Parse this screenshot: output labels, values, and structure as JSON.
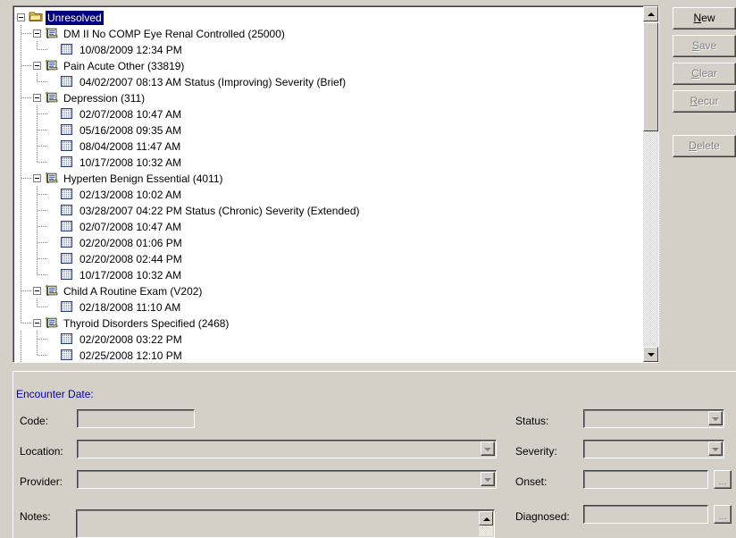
{
  "tree": {
    "root": {
      "label": "Unresolved",
      "icon": "folder-icon",
      "selected": true
    },
    "groups": [
      {
        "label": "DM   II No COMP Eye Renal Controlled (25000)",
        "icon": "diagnosis-icon",
        "entries": [
          {
            "label": "10/08/2009 12:34 PM",
            "icon": "encounter-icon"
          }
        ]
      },
      {
        "label": "Pain Acute Other (33819)",
        "icon": "diagnosis-icon",
        "entries": [
          {
            "label": "04/02/2007 08:13 AM Status (Improving) Severity (Brief)",
            "icon": "encounter-icon"
          }
        ]
      },
      {
        "label": "Depression (311)",
        "icon": "diagnosis-icon",
        "entries": [
          {
            "label": "02/07/2008 10:47 AM",
            "icon": "encounter-icon"
          },
          {
            "label": "05/16/2008 09:35 AM",
            "icon": "encounter-icon"
          },
          {
            "label": "08/04/2008 11:47 AM",
            "icon": "encounter-icon"
          },
          {
            "label": "10/17/2008 10:32 AM",
            "icon": "encounter-icon"
          }
        ]
      },
      {
        "label": "Hyperten  Benign Essential (4011)",
        "icon": "diagnosis-icon",
        "entries": [
          {
            "label": "02/13/2008 10:02 AM",
            "icon": "encounter-icon"
          },
          {
            "label": "03/28/2007 04:22 PM Status (Chronic) Severity (Extended)",
            "icon": "encounter-icon"
          },
          {
            "label": "02/07/2008 10:47 AM",
            "icon": "encounter-icon"
          },
          {
            "label": "02/20/2008 01:06 PM",
            "icon": "encounter-icon"
          },
          {
            "label": "02/20/2008 02:44 PM",
            "icon": "encounter-icon"
          },
          {
            "label": "10/17/2008 10:32 AM",
            "icon": "encounter-icon"
          }
        ]
      },
      {
        "label": "Child A Routine Exam (V202)",
        "icon": "diagnosis-icon",
        "entries": [
          {
            "label": "02/18/2008 11:10 AM",
            "icon": "encounter-icon"
          }
        ]
      },
      {
        "label": "Thyroid Disorders Specified (2468)",
        "icon": "diagnosis-icon",
        "entries": [
          {
            "label": "02/20/2008 03:22 PM",
            "icon": "encounter-icon"
          },
          {
            "label": "02/25/2008 12:10 PM",
            "icon": "encounter-icon"
          }
        ]
      }
    ]
  },
  "buttons": [
    {
      "label": "New",
      "accel": "N",
      "rest": "ew",
      "enabled": true,
      "name": "new-button"
    },
    {
      "label": "Save",
      "accel": "S",
      "rest": "ave",
      "enabled": false,
      "name": "save-button"
    },
    {
      "label": "Clear",
      "accel": "C",
      "rest": "lear",
      "enabled": false,
      "name": "clear-button"
    },
    {
      "label": "Recur",
      "accel": "R",
      "rest": "ecur",
      "enabled": false,
      "name": "recur-button"
    },
    {
      "label": "Delete",
      "accel": "D",
      "rest": "elete",
      "enabled": false,
      "name": "delete-button"
    }
  ],
  "form": {
    "heading": "Encounter Date:",
    "labels": {
      "code": "Code:",
      "location": "Location:",
      "provider": "Provider:",
      "notes": "Notes:",
      "status": "Status:",
      "severity": "Severity:",
      "onset": "Onset:",
      "diagnosed": "Diagnosed:"
    },
    "values": {
      "code": "",
      "location": "",
      "provider": "",
      "notes": "",
      "status": "",
      "severity": "",
      "onset": "",
      "diagnosed": ""
    },
    "ellipsis_label": "...",
    "heading_color": "#0000c0"
  },
  "colors": {
    "window_face": "#d4d0c8",
    "tree_background": "#ffffff",
    "selection": "#000080",
    "selection_text": "#ffffff",
    "disabled_text": "#808080",
    "heading_blue": "#0000c0",
    "folder_yellow": "#e8c84c",
    "encounter_blue": "#4a5fa8"
  },
  "scrollbar": {
    "up_arrow": "scroll-up-icon",
    "down_arrow": "scroll-down-icon",
    "thumb_position_pct": 5
  }
}
